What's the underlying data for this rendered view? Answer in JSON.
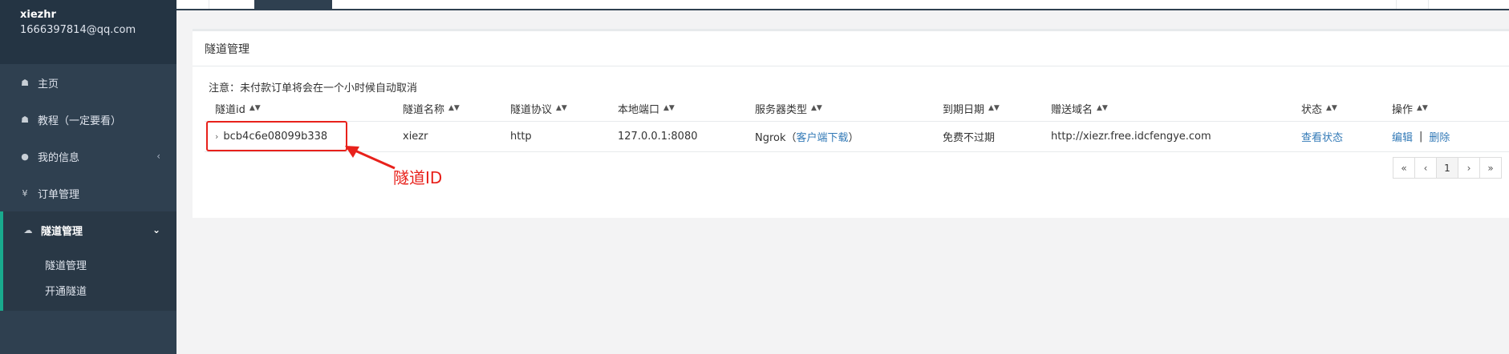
{
  "sidebar": {
    "user": {
      "name": "xiezhr",
      "email": "1666397814@qq.com"
    },
    "items": [
      {
        "label": "主页",
        "icon": "home-icon"
      },
      {
        "label": "教程（一定要看）",
        "icon": "home-icon"
      },
      {
        "label": "我的信息",
        "icon": "user-icon"
      },
      {
        "label": "订单管理",
        "icon": "yen-icon"
      },
      {
        "label": "隧道管理",
        "icon": "cloud-icon"
      }
    ],
    "submenu": [
      {
        "label": "隧道管理"
      },
      {
        "label": "开通隧道"
      }
    ]
  },
  "panel": {
    "title": "隧道管理",
    "notice": "注意：未付款订单将会在一个小时候自动取消"
  },
  "table": {
    "columns": [
      "隧道id",
      "隧道名称",
      "隧道协议",
      "本地端口",
      "服务器类型",
      "到期日期",
      "赠送域名",
      "状态",
      "操作"
    ],
    "rows": [
      {
        "id": "bcb4c6e08099b338",
        "name": "xiezr",
        "protocol": "http",
        "local_port": "127.0.0.1:8080",
        "server_type_prefix": "Ngrok（",
        "server_type_link": "客户端下载",
        "server_type_suffix": "）",
        "expiry": "免费不过期",
        "domain": "http://xiezr.free.idcfengye.com",
        "status": "查看状态",
        "action_edit": "编辑",
        "action_sep": "|",
        "action_delete": "删除"
      }
    ]
  },
  "pagination": {
    "first": "«",
    "prev": "‹",
    "current": "1",
    "next": "›",
    "last": "»"
  },
  "annotation": {
    "label": "隧道ID",
    "color": "#e8211b"
  },
  "colors": {
    "sidebar": "#2f4050",
    "accent": "#19aa8d",
    "link": "#337ab7"
  }
}
